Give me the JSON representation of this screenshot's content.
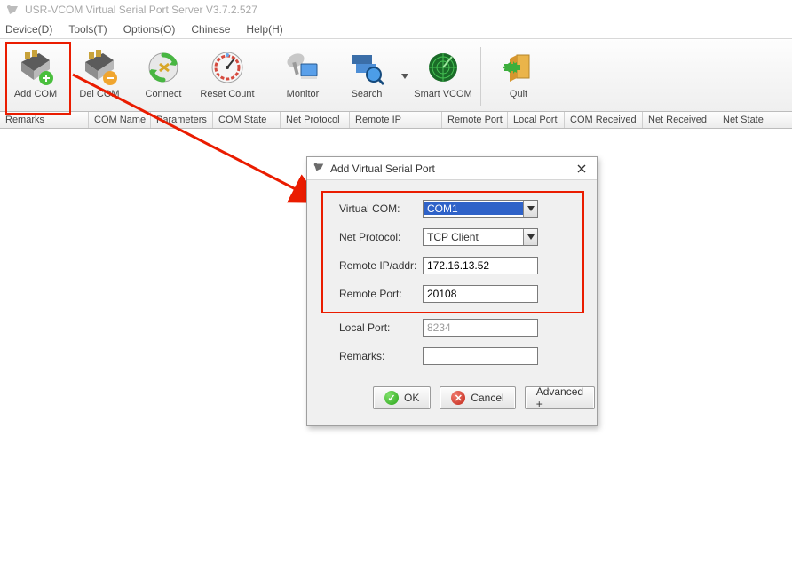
{
  "title": "USR-VCOM Virtual Serial Port Server V3.7.2.527",
  "menu": {
    "device": "Device(D)",
    "tools": "Tools(T)",
    "options": "Options(O)",
    "chinese": "Chinese",
    "help": "Help(H)"
  },
  "toolbar": {
    "add_com": "Add COM",
    "del_com": "Del COM",
    "connect": "Connect",
    "reset_count": "Reset Count",
    "monitor": "Monitor",
    "search": "Search",
    "smart_vcom": "Smart VCOM",
    "quit": "Quit"
  },
  "headers": {
    "remarks": "Remarks",
    "com_name": "COM Name",
    "parameters": "Parameters",
    "com_state": "COM State",
    "net_protocol": "Net Protocol",
    "remote_ip": "Remote IP",
    "remote_port": "Remote Port",
    "local_port": "Local Port",
    "com_received": "COM Received",
    "net_received": "Net Received",
    "net_state": "Net State"
  },
  "dialog": {
    "title": "Add Virtual Serial Port",
    "labels": {
      "virtual_com": "Virtual COM:",
      "net_protocol": "Net Protocol:",
      "remote_ip": "Remote IP/addr:",
      "remote_port": "Remote Port:",
      "local_port": "Local Port:",
      "remarks": "Remarks:"
    },
    "values": {
      "virtual_com": "COM1",
      "net_protocol": "TCP Client",
      "remote_ip": "172.16.13.52",
      "remote_port": "20108",
      "local_port": "8234",
      "remarks": ""
    },
    "buttons": {
      "ok": "OK",
      "cancel": "Cancel",
      "advanced": "Advanced +"
    }
  }
}
